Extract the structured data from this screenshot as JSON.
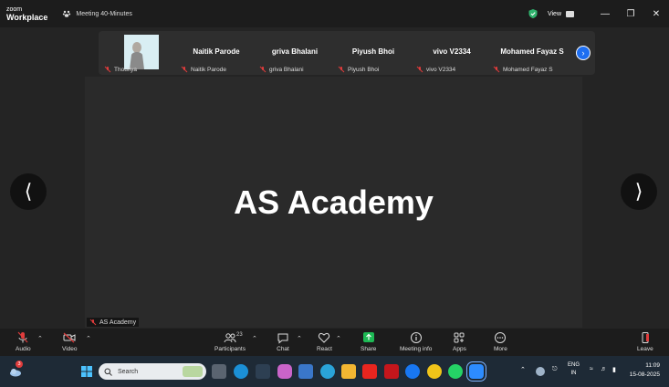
{
  "app": {
    "logo_top": "zoom",
    "logo_bottom": "Workplace",
    "meeting_title": "Meeting 40-Minutes",
    "view_label": "View"
  },
  "participants": [
    {
      "label": "Thoufiya",
      "display_name": "",
      "has_video": true
    },
    {
      "label": "Naitik Parode",
      "display_name": "Naitik Parode"
    },
    {
      "label": "griva Bhalani",
      "display_name": "griva Bhalani"
    },
    {
      "label": "Piyush Bhoi",
      "display_name": "Piyush Bhoi"
    },
    {
      "label": "vivo V2334",
      "display_name": "vivo V2334"
    },
    {
      "label": "Mohamed Fayaz S",
      "display_name": "Mohamed Fayaz S"
    }
  ],
  "stage": {
    "display_name": "AS Academy",
    "label": "AS Academy"
  },
  "toolbar": {
    "audio": "Audio",
    "video": "Video",
    "participants": "Participants",
    "participants_count": "23",
    "chat": "Chat",
    "react": "React",
    "share": "Share",
    "meeting_info": "Meeting info",
    "apps": "Apps",
    "more": "More",
    "leave": "Leave"
  },
  "taskbar": {
    "search_placeholder": "Search",
    "weather_badge": "3",
    "lang_top": "ENG",
    "lang_bottom": "IN",
    "time": "11:09",
    "date": "15-08-2025"
  },
  "colors": {
    "accent_blue": "#1e6ef0",
    "share_green": "#1db954",
    "mic_off_red": "#e03c3c",
    "shield_green": "#2fb36d"
  }
}
